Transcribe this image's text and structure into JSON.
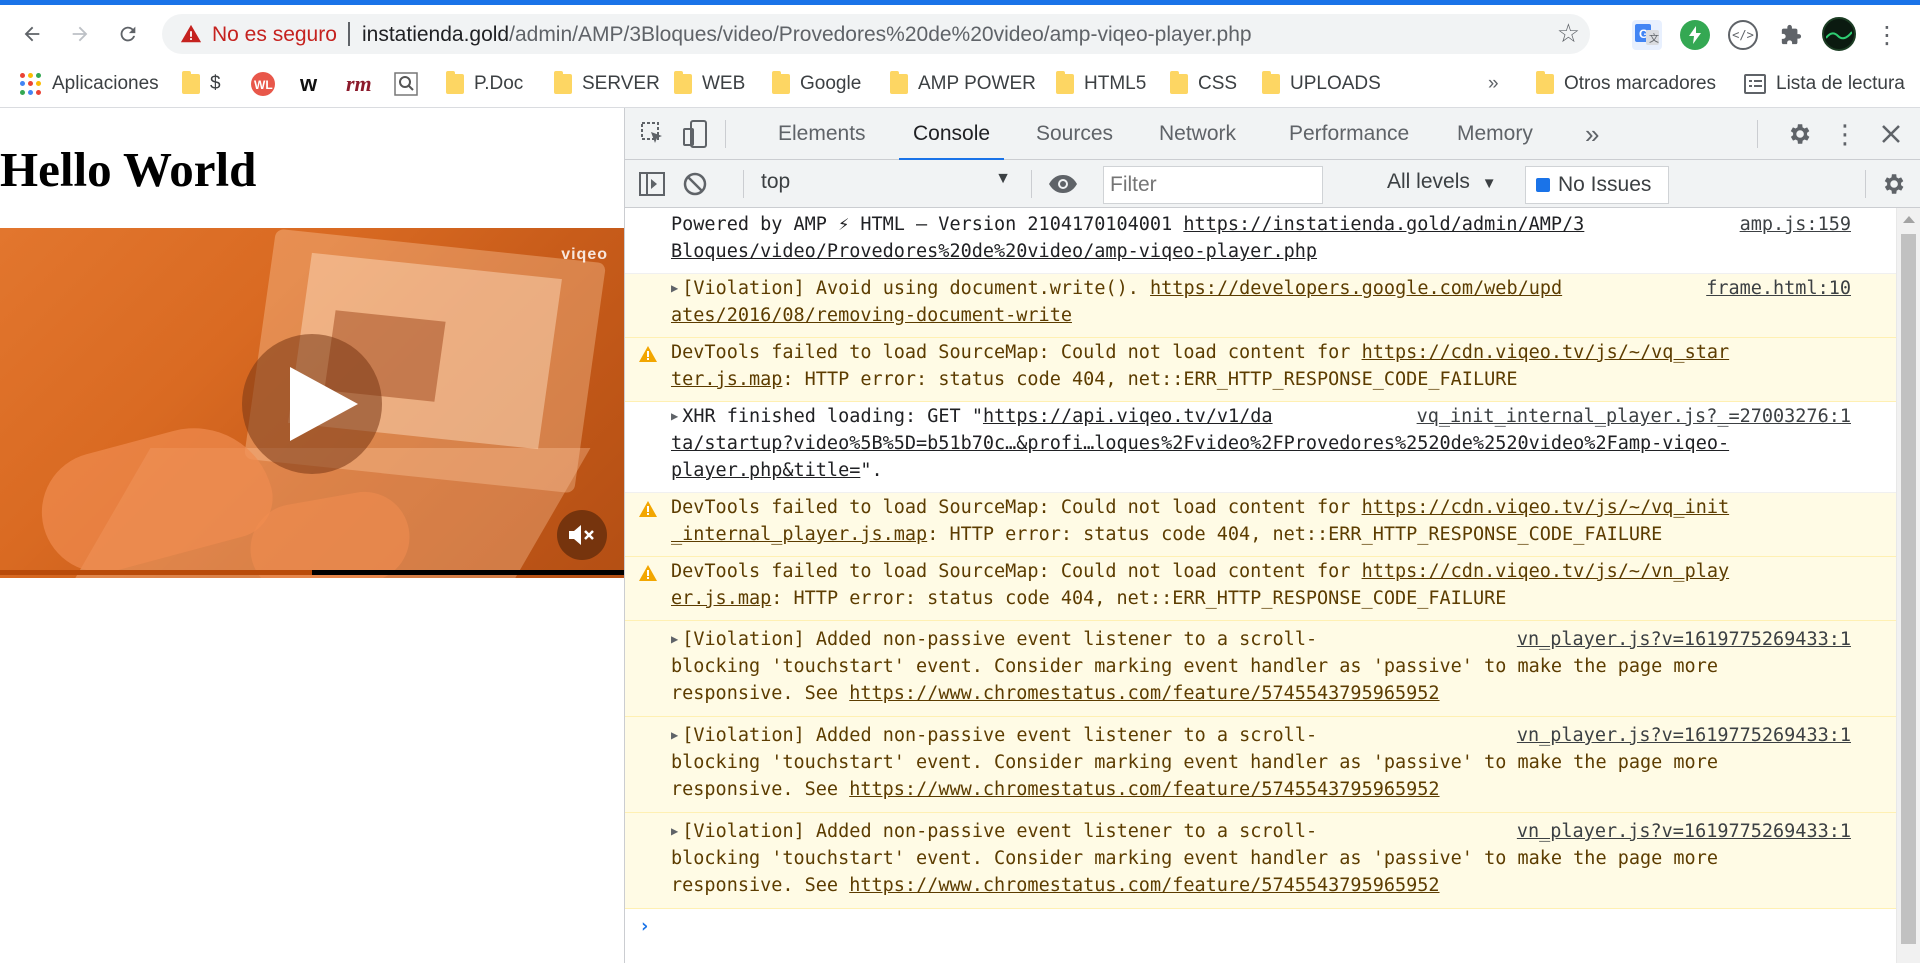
{
  "browser": {
    "omnibox": {
      "security_label": "No es seguro",
      "url_host": "instatienda.gold",
      "url_path": "/admin/AMP/3Bloques/video/Provedores%20de%20video/amp-viqeo-player.php"
    },
    "bookmarks": [
      {
        "label": "Aplicaciones",
        "icon": "apps-icon"
      },
      {
        "label": "$",
        "icon": "folder-icon"
      },
      {
        "label": "",
        "icon": "wl-icon"
      },
      {
        "label": "",
        "icon": "w-icon"
      },
      {
        "label": "",
        "icon": "rm-icon"
      },
      {
        "label": "",
        "icon": "search-box-icon"
      },
      {
        "label": "P.Doc",
        "icon": "folder-icon"
      },
      {
        "label": "SERVER",
        "icon": "folder-icon"
      },
      {
        "label": "WEB",
        "icon": "folder-icon"
      },
      {
        "label": "Google",
        "icon": "folder-icon"
      },
      {
        "label": "AMP POWER",
        "icon": "folder-icon"
      },
      {
        "label": "HTML5",
        "icon": "folder-icon"
      },
      {
        "label": "CSS",
        "icon": "folder-icon"
      },
      {
        "label": "UPLOADS",
        "icon": "folder-icon"
      },
      {
        "label": "»",
        "icon": "overflow-icon"
      },
      {
        "label": "Otros marcadores",
        "icon": "folder-icon"
      },
      {
        "label": "Lista de lectura",
        "icon": "reading-list-icon"
      }
    ]
  },
  "page": {
    "heading": "Hello World",
    "video": {
      "watermark": "viqeo",
      "progress_fraction": 0.5
    }
  },
  "devtools": {
    "tabs": [
      "Elements",
      "Console",
      "Sources",
      "Network",
      "Performance",
      "Memory"
    ],
    "active_tab": "Console",
    "more_tabs": "»",
    "context": "top",
    "filter_placeholder": "Filter",
    "levels": "All levels",
    "issues": "No Issues",
    "messages": [
      {
        "type": "log",
        "expandable": false,
        "parts": [
          {
            "t": "Powered by AMP ⚡ HTML – Version 2104170104001 "
          },
          {
            "t": "https://instatienda.gold/admin/AMP/3",
            "link": true
          },
          {
            "br": true
          },
          {
            "t": "Bloques/video/Provedores%20de%20video/amp-viqeo-player.php",
            "link": true
          }
        ],
        "source": "amp.js:159"
      },
      {
        "type": "violation",
        "expandable": true,
        "parts": [
          {
            "t": "[Violation] Avoid using document.write(). "
          },
          {
            "t": "https://developers.google.com/web/upd",
            "link": true
          },
          {
            "br": true
          },
          {
            "t": "ates/2016/08/removing-document-write",
            "link": true
          }
        ],
        "source": "frame.html:10"
      },
      {
        "type": "warn",
        "expandable": false,
        "parts": [
          {
            "t": "DevTools failed to load SourceMap: Could not load content for "
          },
          {
            "t": "https://cdn.viqeo.tv/js/~/vq_star",
            "link": true
          },
          {
            "br": true
          },
          {
            "t": "ter.js.map",
            "link": true
          },
          {
            "t": ": HTTP error: status code 404, net::ERR_HTTP_RESPONSE_CODE_FAILURE"
          }
        ],
        "source": ""
      },
      {
        "type": "log",
        "expandable": true,
        "parts": [
          {
            "t": "XHR finished loading: GET \""
          },
          {
            "t": "https://api.viqeo.tv/v1/da",
            "link": true
          },
          {
            "br": true
          },
          {
            "t": "ta/startup?video%5B%5D=b51b70c…&profi…loques%2Fvideo%2FProvedores%2520de%2520video%2Famp-viqeo-",
            "link": true
          },
          {
            "br": true
          },
          {
            "t": "player.php&title=",
            "link": true
          },
          {
            "t": "\"."
          }
        ],
        "source": "vq_init_internal_player.js?_=27003276:1"
      },
      {
        "type": "warn",
        "expandable": false,
        "parts": [
          {
            "t": "DevTools failed to load SourceMap: Could not load content for "
          },
          {
            "t": "https://cdn.viqeo.tv/js/~/vq_init",
            "link": true
          },
          {
            "br": true
          },
          {
            "t": "_internal_player.js.map",
            "link": true
          },
          {
            "t": ": HTTP error: status code 404, net::ERR_HTTP_RESPONSE_CODE_FAILURE"
          }
        ],
        "source": ""
      },
      {
        "type": "warn",
        "expandable": false,
        "parts": [
          {
            "t": "DevTools failed to load SourceMap: Could not load content for "
          },
          {
            "t": "https://cdn.viqeo.tv/js/~/vn_play",
            "link": true
          },
          {
            "br": true
          },
          {
            "t": "er.js.map",
            "link": true
          },
          {
            "t": ": HTTP error: status code 404, net::ERR_HTTP_RESPONSE_CODE_FAILURE"
          }
        ],
        "source": ""
      },
      {
        "type": "violation",
        "expandable": true,
        "parts": [
          {
            "t": "[Violation] Added non-passive event listener to a scroll-"
          },
          {
            "br": true
          },
          {
            "t": "blocking 'touchstart' event. Consider marking event handler as 'passive' to make the page more"
          },
          {
            "br": true
          },
          {
            "t": "responsive. See "
          },
          {
            "t": "https://www.chromestatus.com/feature/5745543795965952",
            "link": true
          }
        ],
        "source": "vn_player.js?v=1619775269433:1"
      },
      {
        "type": "violation",
        "expandable": true,
        "parts": [
          {
            "t": "[Violation] Added non-passive event listener to a scroll-"
          },
          {
            "br": true
          },
          {
            "t": "blocking 'touchstart' event. Consider marking event handler as 'passive' to make the page more"
          },
          {
            "br": true
          },
          {
            "t": "responsive. See "
          },
          {
            "t": "https://www.chromestatus.com/feature/5745543795965952",
            "link": true
          }
        ],
        "source": "vn_player.js?v=1619775269433:1"
      },
      {
        "type": "violation",
        "expandable": true,
        "parts": [
          {
            "t": "[Violation] Added non-passive event listener to a scroll-"
          },
          {
            "br": true
          },
          {
            "t": "blocking 'touchstart' event. Consider marking event handler as 'passive' to make the page more"
          },
          {
            "br": true
          },
          {
            "t": "responsive. See "
          },
          {
            "t": "https://www.chromestatus.com/feature/5745543795965952",
            "link": true
          }
        ],
        "source": "vn_player.js?v=1619775269433:1"
      }
    ],
    "prompt_symbol": "›"
  },
  "colors": {
    "accent": "#1a73e8",
    "warn_bg": "#fffbe5",
    "video_orange": "#d96a22",
    "not_secure": "#c5221f"
  }
}
